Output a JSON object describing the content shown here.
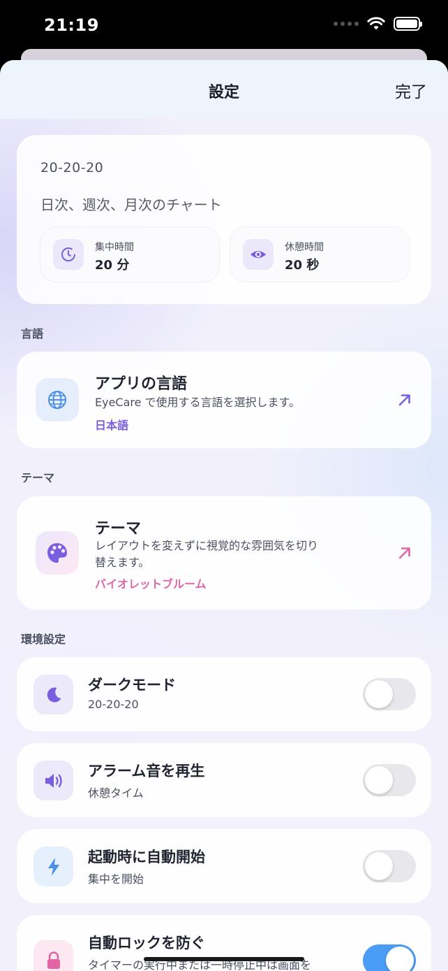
{
  "status_bar": {
    "time": "21:19"
  },
  "nav": {
    "title": "設定",
    "done_label": "完了"
  },
  "summary": {
    "code": "20-20-20",
    "subtitle": "日次、週次、月次のチャート",
    "focus": {
      "label": "集中時間",
      "value": "20 分",
      "icon": "timer-icon"
    },
    "rest": {
      "label": "休憩時間",
      "value": "20 秒",
      "icon": "eye-icon"
    }
  },
  "sections": {
    "language": "言語",
    "theme": "テーマ",
    "preferences": "環境設定"
  },
  "language_card": {
    "title": "アプリの言語",
    "description": "EyeCare で使用する言語を選択します。",
    "value": "日本語",
    "icon": "globe-icon"
  },
  "theme_card": {
    "title": "テーマ",
    "description": "レイアウトを変えずに視覚的な雰囲気を切り替えます。",
    "value": "バイオレットブルーム",
    "icon": "palette-icon"
  },
  "toggles": [
    {
      "title": "ダークモード",
      "subtitle": "20-20-20",
      "on": false,
      "icon": "moon-icon"
    },
    {
      "title": "アラーム音を再生",
      "subtitle": "休憩タイム",
      "on": false,
      "icon": "speaker-icon"
    },
    {
      "title": "起動時に自動開始",
      "subtitle": "集中を開始",
      "on": false,
      "icon": "bolt-icon"
    },
    {
      "title": "自動ロックを防ぐ",
      "subtitle": "タイマーの実行中または一時停止中は画面を",
      "on": true,
      "icon": "lock-icon"
    }
  ],
  "colors": {
    "accent_violet": "#7a5ee0",
    "accent_pink": "#e066a6",
    "switch_on": "#4a9cf5"
  }
}
